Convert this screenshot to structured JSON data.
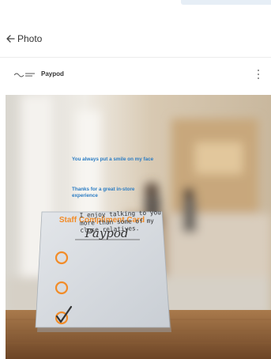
{
  "header": {
    "title": "Photo",
    "back_icon": "arrow-left-icon"
  },
  "post": {
    "account_name": "Paypod",
    "more_icon": "more-vertical-icon"
  },
  "card": {
    "title": "Staff Compliment Card",
    "handwritten_name": "Paypod",
    "items": [
      {
        "text": "You always put a smile on my face",
        "checked": false
      },
      {
        "text": "Thanks for a great in-store experience",
        "checked": false
      },
      {
        "text": "I enjoy talking to you more than some of my close relatives.",
        "checked": true
      }
    ]
  },
  "colors": {
    "card_orange": "#f28c28",
    "card_blue": "#2b7cc3",
    "card_bg": "#d8dde2"
  }
}
